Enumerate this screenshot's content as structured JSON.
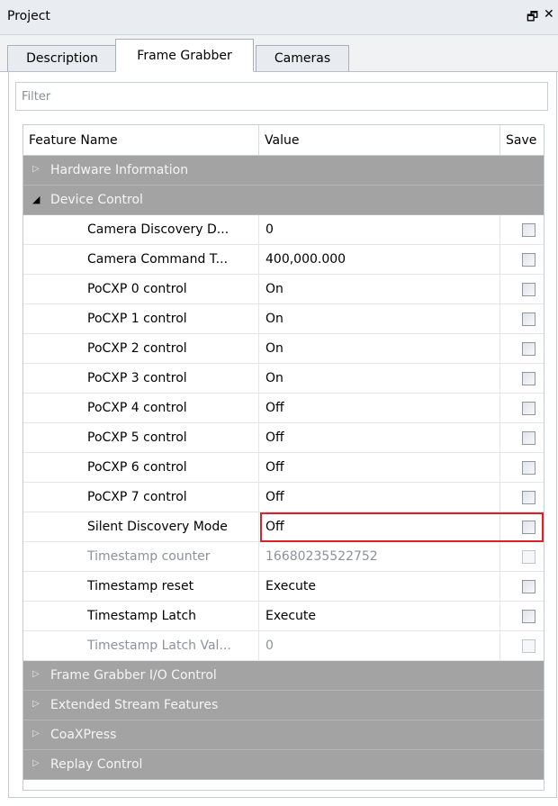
{
  "window": {
    "title": "Project",
    "float_button": "🗗",
    "close_button": "✕"
  },
  "tabs": [
    "Description",
    "Frame Grabber",
    "Cameras"
  ],
  "filter": {
    "placeholder": "Filter",
    "value": ""
  },
  "grid": {
    "headers": {
      "name": "Feature Name",
      "value": "Value",
      "save": "Save"
    },
    "categories": [
      {
        "label": "Hardware Information",
        "expanded": false
      },
      {
        "label": "Device Control",
        "expanded": true
      },
      {
        "label": "Frame Grabber I/O Control",
        "expanded": false
      },
      {
        "label": "Extended Stream Features",
        "expanded": false
      },
      {
        "label": "CoaXPress",
        "expanded": false
      },
      {
        "label": "Replay Control",
        "expanded": false
      }
    ],
    "features": [
      {
        "name": "Camera Discovery D...",
        "value": "0",
        "enabled": true
      },
      {
        "name": "Camera Command T...",
        "value": "400,000.000",
        "enabled": true
      },
      {
        "name": "PoCXP 0 control",
        "value": "On",
        "enabled": true
      },
      {
        "name": "PoCXP 1 control",
        "value": "On",
        "enabled": true
      },
      {
        "name": "PoCXP 2 control",
        "value": "On",
        "enabled": true
      },
      {
        "name": "PoCXP 3 control",
        "value": "On",
        "enabled": true
      },
      {
        "name": "PoCXP 4 control",
        "value": "Off",
        "enabled": true
      },
      {
        "name": "PoCXP 5 control",
        "value": "Off",
        "enabled": true
      },
      {
        "name": "PoCXP 6 control",
        "value": "Off",
        "enabled": true
      },
      {
        "name": "PoCXP 7 control",
        "value": "Off",
        "enabled": true
      },
      {
        "name": "Silent Discovery Mode",
        "value": "Off",
        "enabled": true
      },
      {
        "name": "Timestamp counter",
        "value": "16680235522752",
        "enabled": false
      },
      {
        "name": "Timestamp reset",
        "value": "Execute",
        "enabled": true
      },
      {
        "name": "Timestamp Latch",
        "value": "Execute",
        "enabled": true
      },
      {
        "name": "Timestamp Latch Val...",
        "value": "0",
        "enabled": false
      }
    ]
  },
  "colors": {
    "category_bg": "#a3a3a3",
    "highlight_border": "#e02027"
  }
}
